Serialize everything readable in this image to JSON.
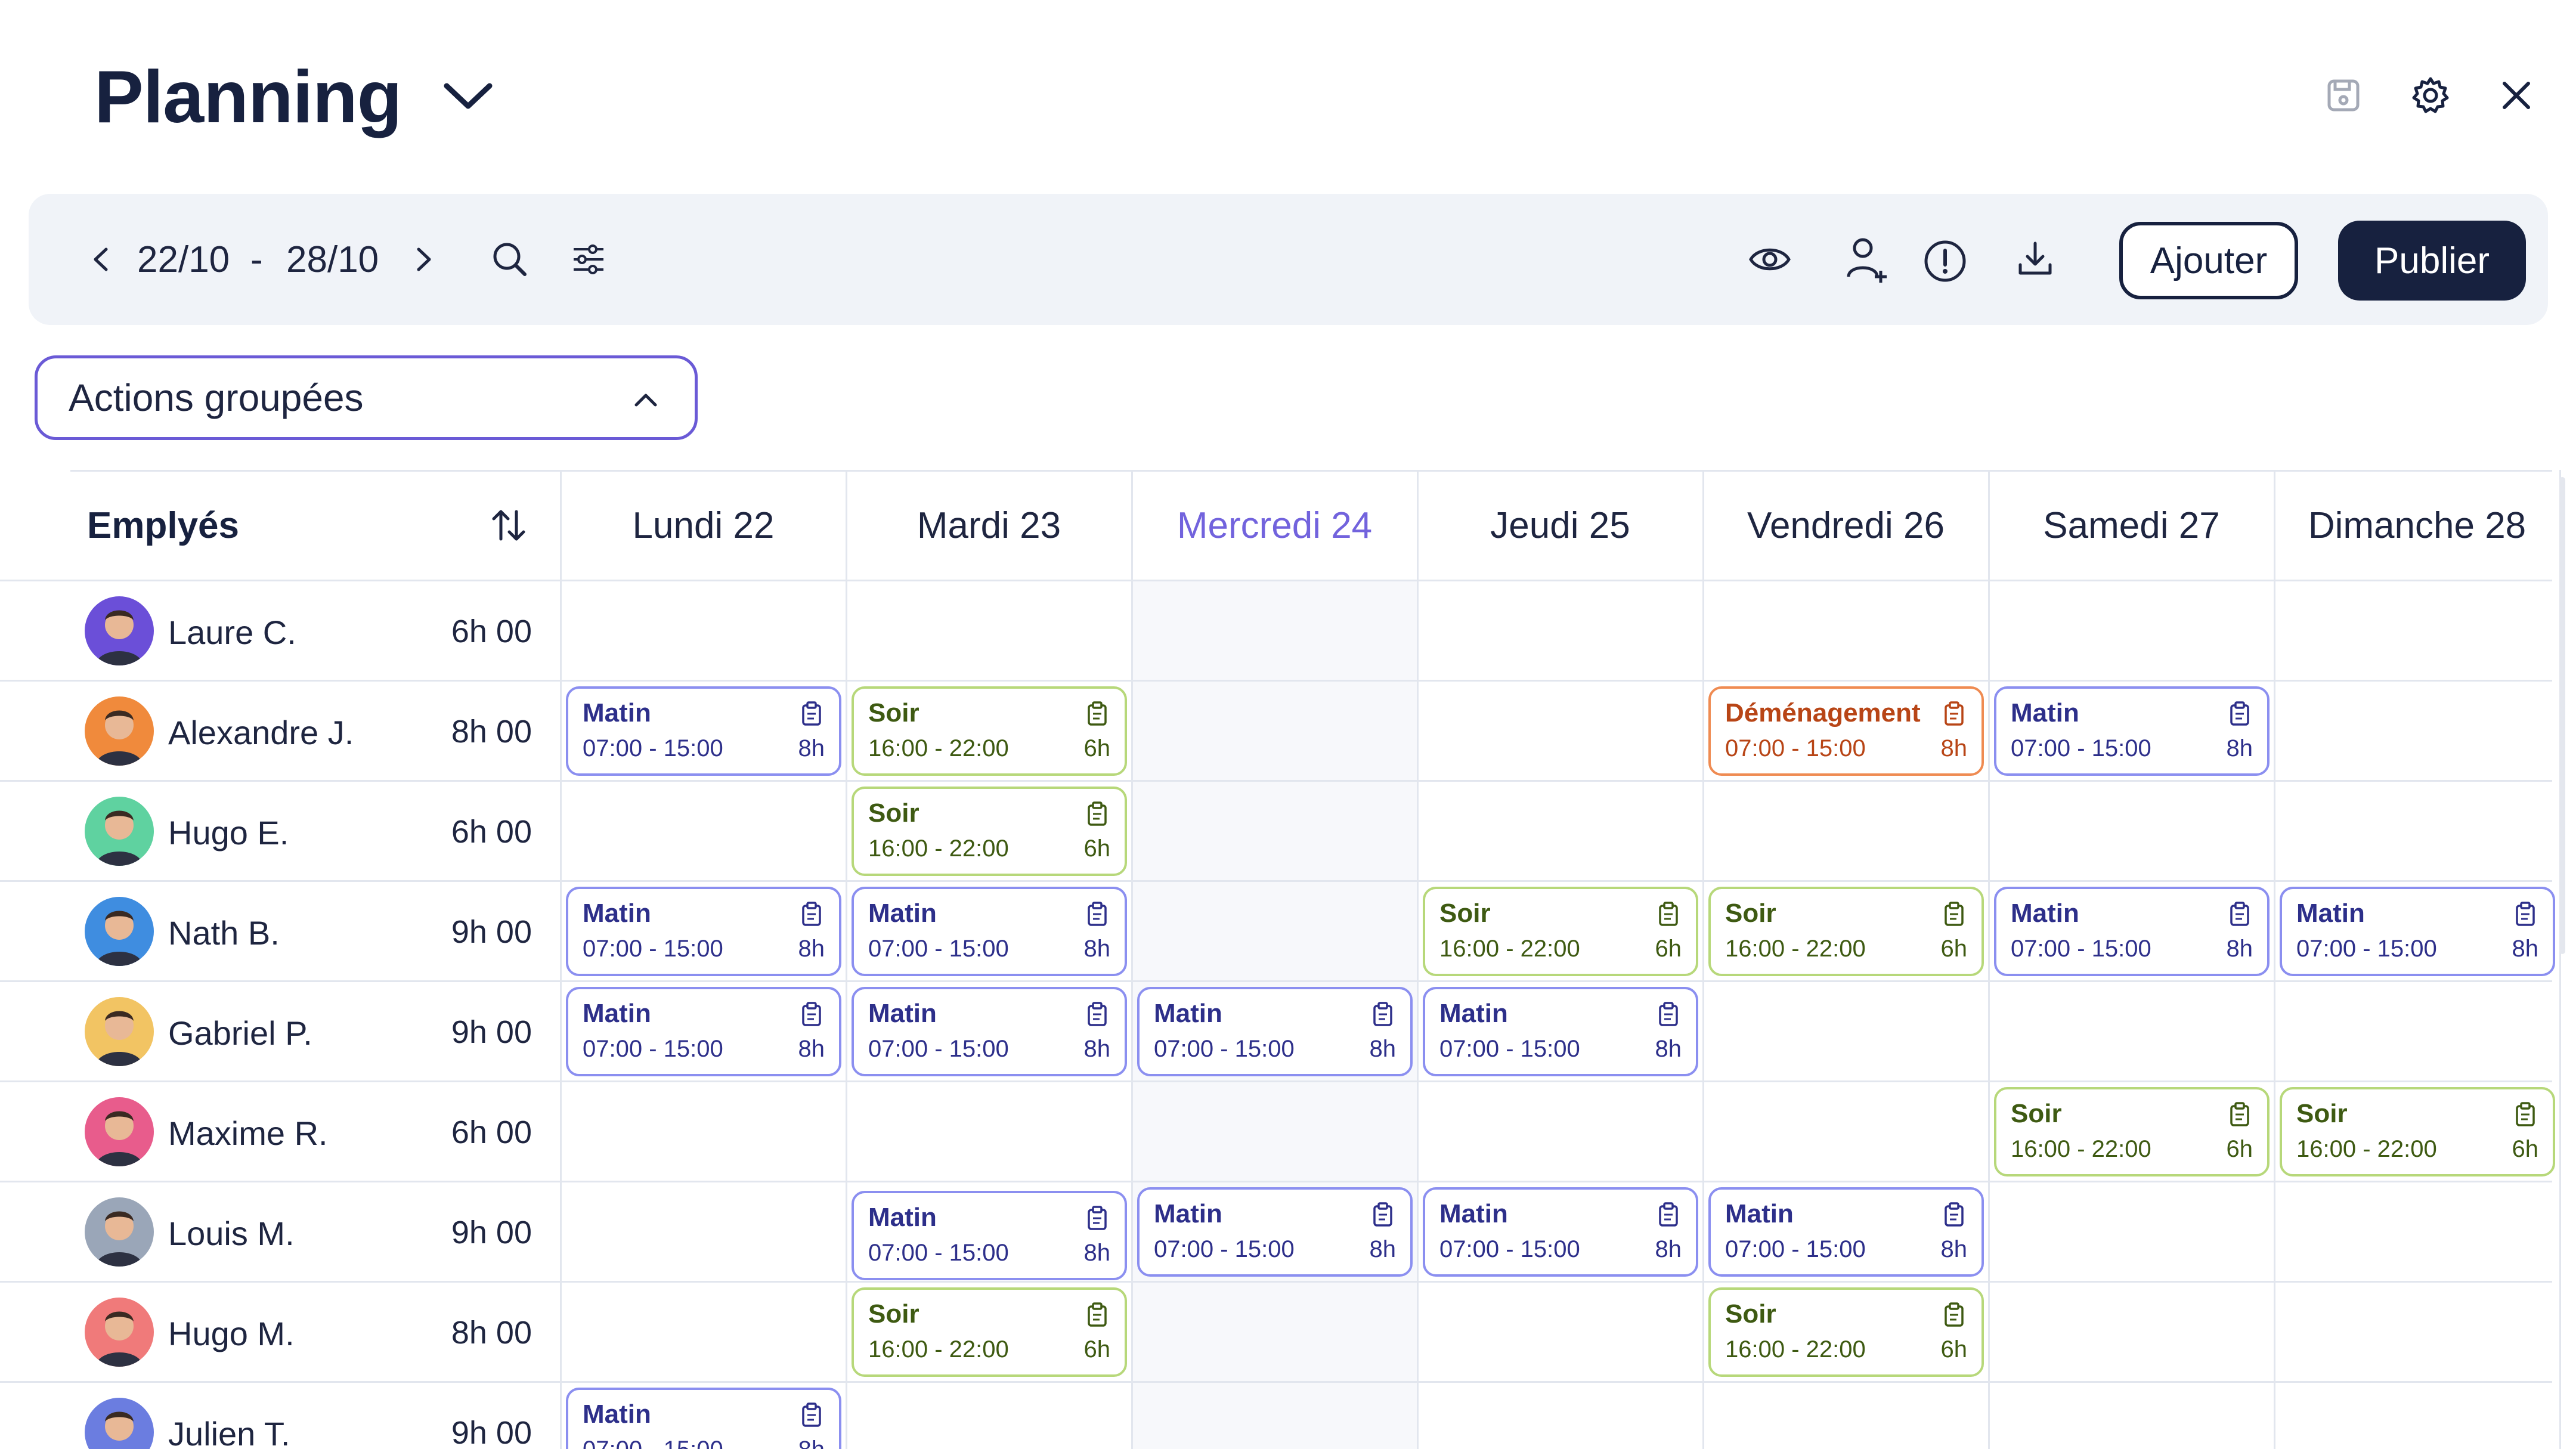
{
  "header": {
    "title": "Planning",
    "icons": [
      "chevron-down-icon",
      "save-icon",
      "gear-icon",
      "close-icon"
    ]
  },
  "toolbar": {
    "date_start": "22/10",
    "date_sep": "-",
    "date_end": "28/10",
    "add_label": "Ajouter",
    "publish_label": "Publier",
    "icons": [
      "chevron-left-icon",
      "chevron-right-icon",
      "search-icon",
      "filter-icon",
      "eye-icon",
      "add-user-icon",
      "alert-icon",
      "download-icon"
    ]
  },
  "bulk_actions": {
    "label": "Actions groupées"
  },
  "grid": {
    "employees_header": "Emplyés",
    "days": [
      "Lundi 22",
      "Mardi 23",
      "Mercredi 24",
      "Jeudi 25",
      "Vendredi 26",
      "Samedi 27",
      "Dimanche 28"
    ],
    "today_index": 2,
    "employees": [
      {
        "name": "Laure C.",
        "hours": "6h 00",
        "avatar_color": "#6b4fd8"
      },
      {
        "name": "Alexandre J.",
        "hours": "8h 00",
        "avatar_color": "#f08a3c"
      },
      {
        "name": "Hugo E.",
        "hours": "6h 00",
        "avatar_color": "#5fd2a0"
      },
      {
        "name": "Nath B.",
        "hours": "9h 00",
        "avatar_color": "#3f8de0"
      },
      {
        "name": "Gabriel P.",
        "hours": "9h 00",
        "avatar_color": "#f2c463"
      },
      {
        "name": "Maxime R.",
        "hours": "6h 00",
        "avatar_color": "#e85c8c"
      },
      {
        "name": "Louis M.",
        "hours": "9h 00",
        "avatar_color": "#9aa6b8"
      },
      {
        "name": "Hugo M.",
        "hours": "8h 00",
        "avatar_color": "#f07a7a"
      },
      {
        "name": "Julien T.",
        "hours": "9h 00",
        "avatar_color": "#6b7de0"
      }
    ],
    "shift_types": {
      "matin": {
        "name": "Matin",
        "time": "07:00 - 15:00",
        "duration": "8h"
      },
      "soir": {
        "name": "Soir",
        "time": "16:00 - 22:00",
        "duration": "6h"
      },
      "demen": {
        "name": "Déménagement",
        "time": "07:00 - 15:00",
        "duration": "8h"
      }
    },
    "shifts": [
      {
        "type": "matin",
        "day": 0,
        "row": 1
      },
      {
        "type": "soir",
        "day": 1,
        "row": 1
      },
      {
        "type": "demen",
        "day": 4,
        "row": 1
      },
      {
        "type": "matin",
        "day": 5,
        "row": 1
      },
      {
        "type": "soir",
        "day": 1,
        "row": 2
      },
      {
        "type": "matin",
        "day": 0,
        "row": 3
      },
      {
        "type": "matin",
        "day": 1,
        "row": 3
      },
      {
        "type": "soir",
        "day": 3,
        "row": 3
      },
      {
        "type": "soir",
        "day": 4,
        "row": 3
      },
      {
        "type": "matin",
        "day": 5,
        "row": 3
      },
      {
        "type": "matin",
        "day": 6,
        "row": 3
      },
      {
        "type": "matin",
        "day": 0,
        "row": 4
      },
      {
        "type": "matin",
        "day": 1,
        "row": 4
      },
      {
        "type": "matin",
        "day": 2,
        "row": 4
      },
      {
        "type": "matin",
        "day": 3,
        "row": 4
      },
      {
        "type": "soir",
        "day": 5,
        "row": 5
      },
      {
        "type": "soir",
        "day": 6,
        "row": 5
      },
      {
        "type": "matin",
        "day": 1,
        "row": 6,
        "nudge": 1
      },
      {
        "type": "matin",
        "day": 2,
        "row": 6
      },
      {
        "type": "matin",
        "day": 3,
        "row": 6
      },
      {
        "type": "matin",
        "day": 4,
        "row": 6
      },
      {
        "type": "soir",
        "day": 1,
        "row": 7
      },
      {
        "type": "soir",
        "day": 4,
        "row": 7
      },
      {
        "type": "matin",
        "day": 0,
        "row": 8
      }
    ]
  }
}
